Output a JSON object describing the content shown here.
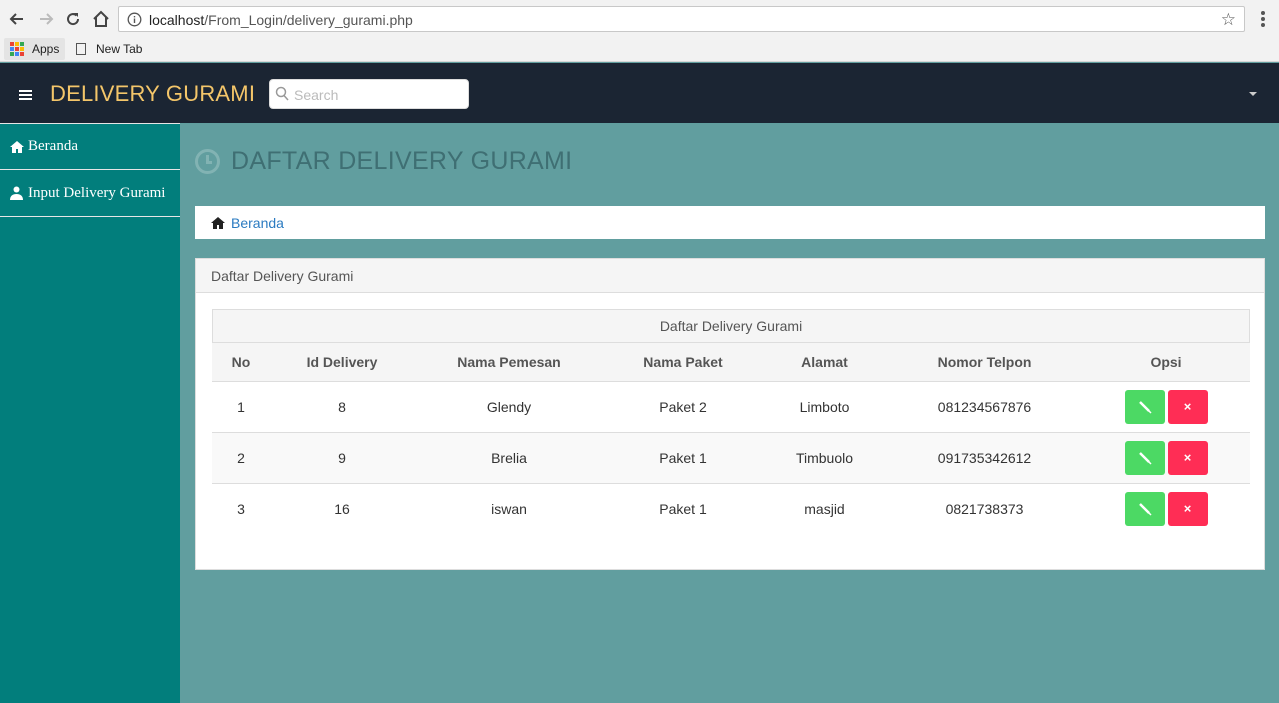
{
  "browser": {
    "url_host": "localhost",
    "url_path": "/From_Login/delivery_gurami.php",
    "bookmarks": [
      {
        "label": "Apps"
      },
      {
        "label": "New Tab"
      }
    ]
  },
  "navbar": {
    "brand": "DELIVERY GURAMI",
    "search_placeholder": "Search",
    "brand_color": "#f4c66a"
  },
  "sidebar": {
    "items": [
      {
        "label": "Beranda",
        "icon": "home-icon"
      },
      {
        "label": "Input Delivery Gurami",
        "icon": "user-icon"
      }
    ]
  },
  "main": {
    "title": "DAFTAR DELIVERY GURAMI",
    "breadcrumb": "Beranda",
    "panel_heading": "Daftar Delivery Gurami",
    "table_caption": "Daftar Delivery Gurami",
    "columns": [
      "No",
      "Id Delivery",
      "Nama Pemesan",
      "Nama Paket",
      "Alamat",
      "Nomor Telpon",
      "Opsi"
    ],
    "rows": [
      {
        "no": "1",
        "id": "8",
        "nama": "Glendy",
        "paket": "Paket 2",
        "alamat": "Limboto",
        "telpon": "081234567876"
      },
      {
        "no": "2",
        "id": "9",
        "nama": "Brelia",
        "paket": "Paket 1",
        "alamat": "Timbuolo",
        "telpon": "091735342612"
      },
      {
        "no": "3",
        "id": "16",
        "nama": "iswan",
        "paket": "Paket 1",
        "alamat": "masjid",
        "telpon": "0821738373"
      }
    ],
    "delete_label": "×",
    "colors": {
      "edit": "#4cd964",
      "delete": "#ff2d55",
      "sidebar": "#027e7c",
      "background": "#619e9f"
    }
  }
}
